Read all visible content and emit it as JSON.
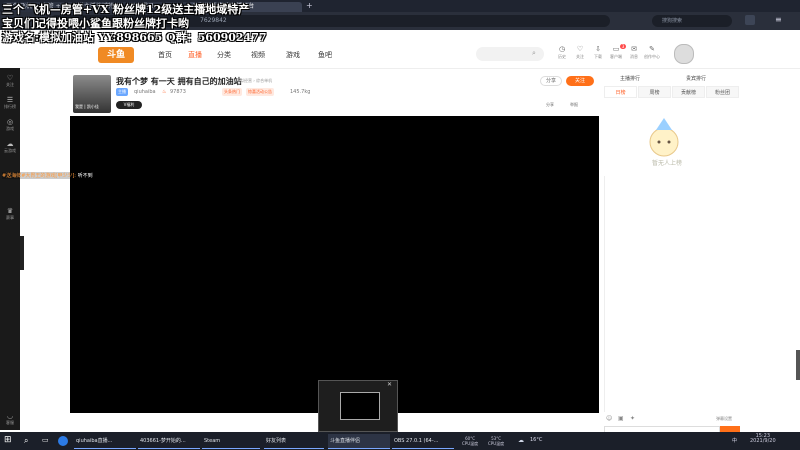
{
  "browser": {
    "tabs": [
      "三个 飞机 — 房管 +VX 粉丝牌1",
      "1级送主播地域特产",
      "斗鱼登录",
      "斗鱼直播-游戏直播平台"
    ],
    "url_fragment": "7629842",
    "new_tab": "+",
    "search_placeholder": "搜狗搜索"
  },
  "overlay": {
    "line1": "三个 飞机—房管+VX 粉丝牌12级送主播地域特产",
    "line2": "宝贝们记得投喂小鲨鱼跟粉丝牌打卡哟",
    "line3": "游戏名:模拟加油站 YY:898665 Q群：560902477"
  },
  "site": {
    "logo": "斗鱼",
    "nav": [
      "首页",
      "直播",
      "分类",
      "视频",
      "游戏",
      "鱼吧"
    ],
    "nav_active_index": 1,
    "header_icons": [
      {
        "icon": "history-icon",
        "label": "历史"
      },
      {
        "icon": "follow-icon",
        "label": "关注"
      },
      {
        "icon": "download-icon",
        "label": "下载"
      },
      {
        "icon": "client-icon",
        "label": "客户端"
      },
      {
        "icon": "message-icon",
        "label": "消息"
      },
      {
        "icon": "creator-icon",
        "label": "创作中心"
      }
    ],
    "notification_count": "3"
  },
  "left_rail": [
    {
      "icon": "heart-icon",
      "label": "关注"
    },
    {
      "icon": "rank-icon",
      "label": "排行榜"
    },
    {
      "icon": "game-icon",
      "label": "游戏"
    },
    {
      "icon": "cloud-game-icon",
      "label": "云游戏"
    },
    {
      "icon": "trophy-icon",
      "label": "赛事"
    },
    {
      "icon": "headset-icon",
      "label": "客服"
    }
  ],
  "room": {
    "title": "我有个梦 有一天 拥有自己的加油站",
    "category": "模拟经营 › 综合单机",
    "streamer": "qiuhaiba",
    "hot": "97873",
    "owner": "主播",
    "badge1": "头条热门",
    "badge2": "惊喜活动公告",
    "weight": "145.7kg",
    "vbadge": "V福利",
    "share": "分享",
    "follow": "关注",
    "actions": [
      "分享",
      "举报"
    ],
    "avatar_name": "我是 | 凯小佳"
  },
  "danmu": {
    "sender": "#送海鲜#大胃王的游戏[甲少少]",
    "message": "听不到"
  },
  "right_panel": {
    "tabs_top": [
      "主播排行",
      "贵宾排行"
    ],
    "tabs": [
      "日榜",
      "周榜",
      "贡献榜",
      "粉丝团"
    ],
    "active_tab": 0,
    "empty_text": "暂无人上榜",
    "chat_tools_label": "弹幕设置"
  },
  "taskbar": {
    "items": [
      {
        "icon": "chrome-icon",
        "label": "qiuhaiba直播..."
      },
      {
        "icon": "game-icon",
        "label": "403661-梦开始的..."
      },
      {
        "icon": "steam-icon",
        "label": "Steam"
      },
      {
        "icon": "steam-icon",
        "label": "好友列表"
      },
      {
        "icon": "douyu-icon",
        "label": "斗鱼直播伴侣"
      },
      {
        "icon": "obs-icon",
        "label": "OBS 27.0.1 (64-..."
      }
    ],
    "cpu_temp": "60°C",
    "cpu_temp_label": "CPU温度",
    "gpu_temp": "53°C",
    "gpu_temp_label": "CPU温度",
    "weather": "16°C",
    "time": "15:23",
    "date": "2021/9/20",
    "lang": "中"
  }
}
